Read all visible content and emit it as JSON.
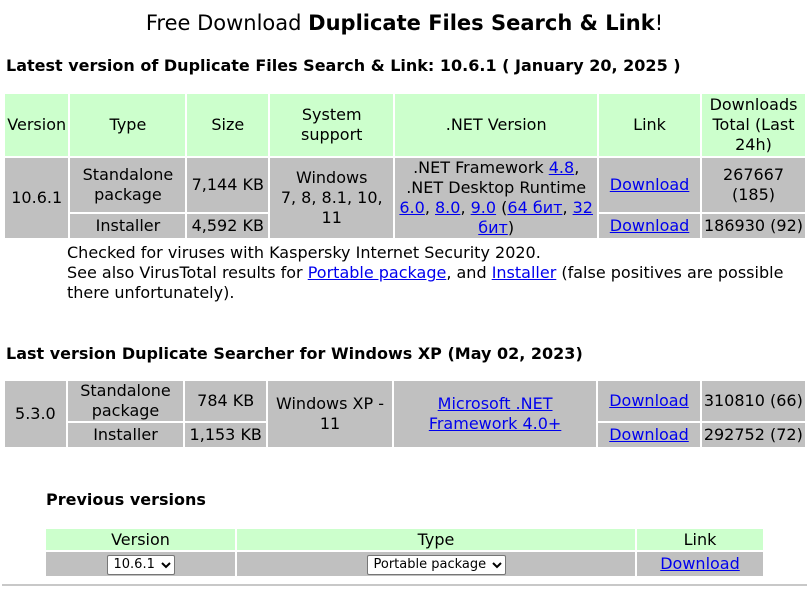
{
  "page": {
    "title_prefix": "Free Download ",
    "title_bold": "Duplicate Files Search & Link",
    "title_suffix": "!"
  },
  "latest": {
    "heading": "Latest version of Duplicate Files Search & Link: 10.6.1 ( January 20, 2025 )",
    "headers": {
      "version": "Version",
      "type": "Type",
      "size": "Size",
      "system": "System support",
      "net": ".NET Version",
      "link": "Link",
      "downloads": "Downloads Total (Last 24h)"
    },
    "version": "10.6.1",
    "system_line1": "Windows",
    "system_line2": "7, 8, 8.1, 10, 11",
    "net_text_a": ".NET Framework ",
    "net_link_48": "4.8",
    "net_text_b": ", .NET Desktop Runtime ",
    "net_link_60": "6.0",
    "net_sep1": ", ",
    "net_link_80": "8.0",
    "net_sep2": ", ",
    "net_link_90": "9.0",
    "net_text_c": " (",
    "net_link_64": "64 бит",
    "net_sep3": ", ",
    "net_link_32": "32 бит",
    "net_text_d": ")",
    "rows": [
      {
        "type": "Standalone package",
        "size": "7,144 KB",
        "link": "Download",
        "downloads": "267667 (185)"
      },
      {
        "type": "Installer",
        "size": "4,592 KB",
        "link": "Download",
        "downloads": "186930 (92)"
      }
    ]
  },
  "note": {
    "line1": "Checked for viruses with Kaspersky Internet Security 2020.",
    "line2_a": "See also VirusTotal results for ",
    "link_portable": "Portable package",
    "line2_b": ",  and ",
    "link_installer": "Installer",
    "line2_c": " (false positives are possible there unfortunately)."
  },
  "xp": {
    "heading": "Last version Duplicate Searcher for Windows XP (May 02, 2023)",
    "version": "5.3.0",
    "system": "Windows XP - 11",
    "net_link": "Microsoft .NET Framework 4.0+",
    "rows": [
      {
        "type": "Standalone package",
        "size": "784 KB",
        "link": "Download",
        "downloads": "310810 (66)"
      },
      {
        "type": "Installer",
        "size": "1,153 KB",
        "link": "Download",
        "downloads": "292752 (72)"
      }
    ]
  },
  "previous": {
    "heading": "Previous versions",
    "headers": {
      "version": "Version",
      "type": "Type",
      "link": "Link"
    },
    "version_selected": "10.6.1",
    "type_selected": "Portable package",
    "link": "Download"
  }
}
